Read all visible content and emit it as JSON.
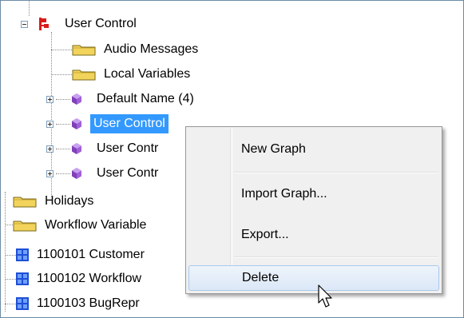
{
  "tree": {
    "user_control_root": "User Control",
    "audio_messages": "Audio Messages",
    "local_variables": "Local Variables",
    "default_name": "Default Name (4)",
    "user_control_selected": "User Control",
    "user_control_2": "User Contr",
    "user_control_3": "User Contr",
    "holidays": "Holidays",
    "workflow_variables": "Workflow Variable",
    "item_1100101": "1100101 Customer",
    "item_1100102": "1100102 Workflow",
    "item_1100103": "1100103 BugRepr"
  },
  "context_menu": {
    "new_graph": "New Graph",
    "import_graph": "Import Graph...",
    "export": "Export...",
    "delete": "Delete"
  },
  "colors": {
    "selection": "#3399ff",
    "folder": "#f2d45c",
    "cube": "#a060d8",
    "flow_icon": "#d81b1b",
    "grid_icon": "#1f4fd6"
  }
}
